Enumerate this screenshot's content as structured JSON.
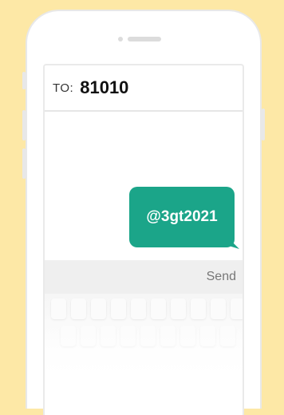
{
  "message": {
    "to_label": "TO:",
    "to_number": "81010",
    "bubble_text": "@3gt2021",
    "send_label": "Send"
  },
  "colors": {
    "background": "#fde8a6",
    "bubble": "#1ba589",
    "send_bar": "#efefef"
  }
}
